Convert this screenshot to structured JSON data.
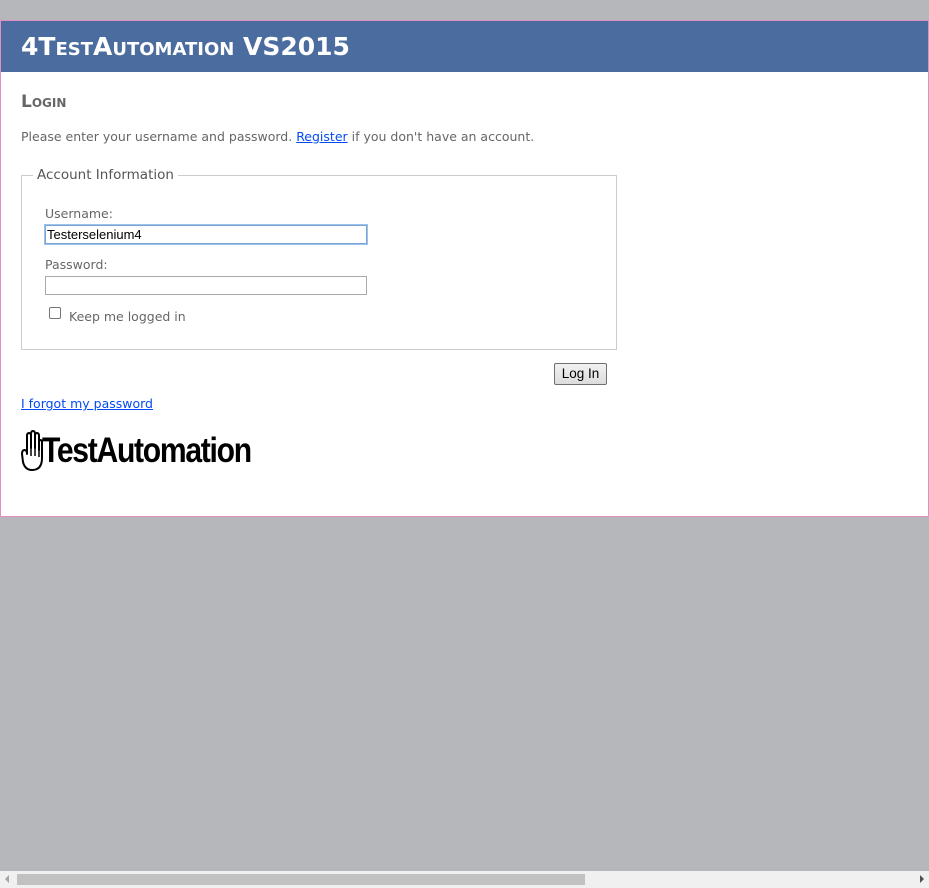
{
  "header": {
    "title": "4TestAutomation VS2015"
  },
  "main": {
    "page_title": "Login",
    "intro_before": "Please enter your username and password. ",
    "register_link": "Register",
    "intro_after": " if you don't have an account.",
    "fieldset_legend": "Account Information",
    "username_label": "Username:",
    "username_value": "Testerselenium4",
    "password_label": "Password:",
    "password_value": "",
    "remember_label": "Keep me logged in",
    "remember_checked": false,
    "login_button": "Log In",
    "forgot_link": "I forgot my password",
    "logo_text": "TestAutomation"
  },
  "icons": {
    "logo_hand": "hand-icon",
    "scroll_left": "chevron-left-icon",
    "scroll_right": "chevron-right-icon"
  },
  "colors": {
    "header_bg": "#4b6c9e",
    "page_border": "#e38ec2",
    "link": "#034af3",
    "backdrop": "#b6b7bb"
  }
}
